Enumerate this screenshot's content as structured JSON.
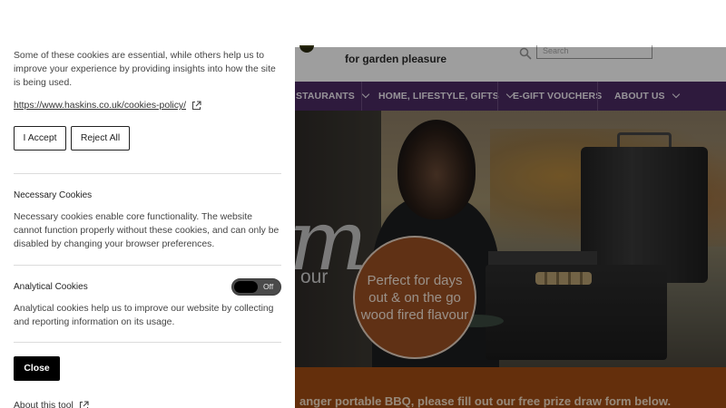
{
  "site": {
    "tagline": "for garden pleasure",
    "search_placeholder": "Search",
    "nav": [
      {
        "label": "STAURANTS",
        "has_dropdown": true
      },
      {
        "label": "HOME, LIFESTYLE, GIFTS",
        "has_dropdown": true
      },
      {
        "label": "E-GIFT VOUCHERS",
        "has_dropdown": false
      },
      {
        "label": "ABOUT US",
        "has_dropdown": true
      }
    ],
    "hero": {
      "big_letter": "m",
      "partial_text": "our",
      "promo_circle_lines": [
        "Perfect for days",
        "out & on the go",
        "wood fired flavour"
      ]
    },
    "promo_bar_text": "anger portable BBQ, please fill out our free prize draw form below."
  },
  "cookie_panel": {
    "intro": "Some of these cookies are essential, while others help us to improve your experience by providing insights into how the site is being used.",
    "policy_link": "https://www.haskins.co.uk/cookies-policy/",
    "accept_label": "I Accept",
    "reject_label": "Reject All",
    "necessary": {
      "title": "Necessary Cookies",
      "description": "Necessary cookies enable core functionality. The website cannot function properly without these cookies, and can only be disabled by changing your browser preferences."
    },
    "analytical": {
      "title": "Analytical Cookies",
      "toggle_state": "Off",
      "description": "Analytical cookies help us to improve our website by collecting and reporting information on its usage."
    },
    "close_label": "Close",
    "about_label": "About this tool"
  },
  "colors": {
    "nav_purple": "#4b2a63",
    "promo_orange": "#a24d14",
    "circle_orange": "#9c4f23"
  }
}
